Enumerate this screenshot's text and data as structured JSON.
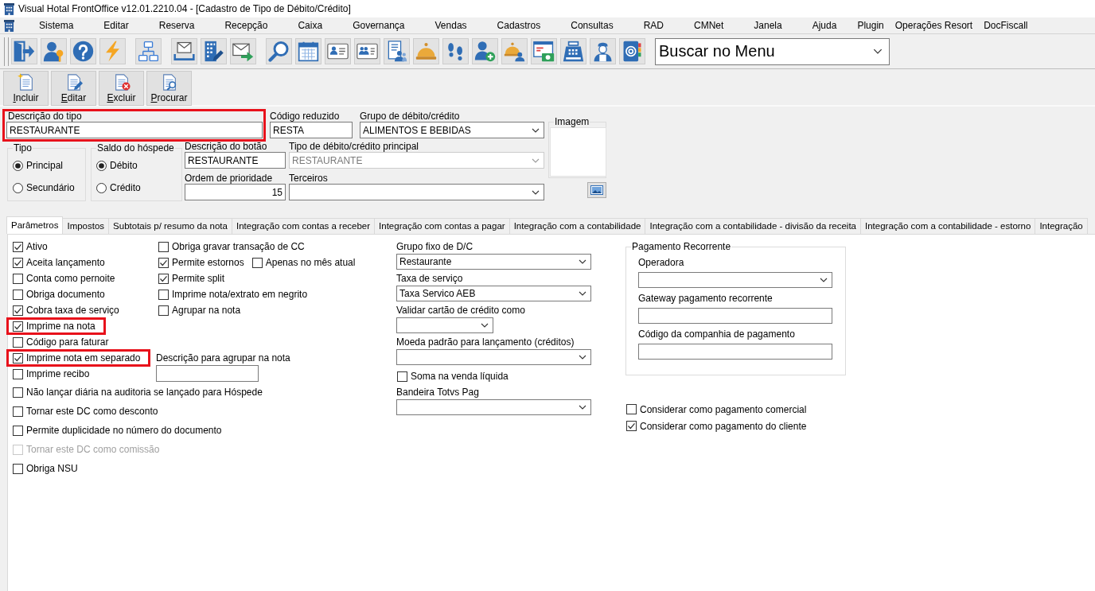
{
  "window": {
    "title": "Visual Hotal FrontOffice v12.01.2210.04 - [Cadastro de Tipo de Débito/Crédito]"
  },
  "menu_bar": [
    "Sistema",
    "Editar",
    "Reserva",
    "Recepção",
    "Caixa",
    "Governança",
    "Vendas",
    "Cadastros",
    "Consultas",
    "RAD",
    "CMNet",
    "Janela",
    "Ajuda",
    "Plugin",
    "Operações Resort",
    "DocFiscall"
  ],
  "toolbar": {
    "menu_search": {
      "value": "Buscar no Menu"
    }
  },
  "action_buttons": [
    "Incluir",
    "Editar",
    "Excluir",
    "Procurar"
  ],
  "form": {
    "descricao_do_tipo": {
      "label": "Descrição do tipo",
      "value": "RESTAURANTE",
      "highlighted": true
    },
    "codigo_reduzido": {
      "label": "Código reduzido",
      "value": "RESTA"
    },
    "grupo_de_debito_credito": {
      "label": "Grupo de débito/crédito",
      "value": "ALIMENTOS E BEBIDAS"
    },
    "imagem": {
      "label": "Imagem"
    },
    "tipo": {
      "label": "Tipo",
      "options": [
        {
          "label": "Principal",
          "selected": true
        },
        {
          "label": "Secundário",
          "selected": false
        }
      ]
    },
    "saldo_do_hospede": {
      "label": "Saldo do hóspede",
      "options": [
        {
          "label": "Débito",
          "selected": true
        },
        {
          "label": "Crédito",
          "selected": false
        }
      ]
    },
    "descricao_do_botao": {
      "label": "Descrição do botão",
      "value": "RESTAURANTE"
    },
    "tipo_principal": {
      "label": "Tipo de débito/crédito principal",
      "value": "RESTAURANTE",
      "disabled": true
    },
    "ordem_de_prioridade": {
      "label": "Ordem de prioridade",
      "value": "15"
    },
    "terceiros": {
      "label": "Terceiros"
    }
  },
  "tabs": [
    {
      "label": "Parâmetros",
      "selected": true
    },
    {
      "label": "Impostos",
      "selected": false
    },
    {
      "label": "Subtotais p/ resumo da nota",
      "selected": false
    },
    {
      "label": "Integração com contas a receber",
      "selected": false
    },
    {
      "label": "Integração com contas a pagar",
      "selected": false
    },
    {
      "label": "Integração com a contabilidade",
      "selected": false
    },
    {
      "label": "Integração com a contabilidade - divisão da receita",
      "selected": false
    },
    {
      "label": "Integração com a contabilidade - estorno",
      "selected": false
    },
    {
      "label": "Integração",
      "selected": false
    }
  ],
  "parametros": {
    "column_1": [
      {
        "label": "Ativo",
        "checked": true,
        "disabled": false,
        "highlighted": false
      },
      {
        "label": "Aceita lançamento",
        "checked": true,
        "disabled": false,
        "highlighted": false
      },
      {
        "label": "Conta como pernoite",
        "checked": false,
        "disabled": false,
        "highlighted": false
      },
      {
        "label": "Obriga documento",
        "checked": false,
        "disabled": false,
        "highlighted": false
      },
      {
        "label": "Cobra taxa de serviço",
        "checked": true,
        "disabled": false,
        "highlighted": false
      },
      {
        "label": "Imprime na nota",
        "checked": true,
        "disabled": false,
        "highlighted": true
      },
      {
        "label": "Código para faturar",
        "checked": false,
        "disabled": false,
        "highlighted": false
      },
      {
        "label": "Imprime nota em separado",
        "checked": true,
        "disabled": false,
        "highlighted": true
      },
      {
        "label": "Imprime recibo",
        "checked": false,
        "disabled": false,
        "highlighted": false
      },
      {
        "label": "Não lançar diária na auditoria se lançado para Hóspede",
        "checked": false,
        "disabled": false,
        "highlighted": false
      },
      {
        "label": "Tornar este DC como desconto",
        "checked": false,
        "disabled": false,
        "highlighted": false
      },
      {
        "label": "Permite duplicidade no número do documento",
        "checked": false,
        "disabled": false,
        "highlighted": false
      },
      {
        "label": "Tornar este DC como comissão",
        "checked": false,
        "disabled": true,
        "highlighted": false
      },
      {
        "label": "Obriga NSU",
        "checked": false,
        "disabled": false,
        "highlighted": false
      }
    ],
    "column_2": [
      [
        {
          "label": "Obriga gravar transação de CC",
          "checked": false
        }
      ],
      [
        {
          "label": "Permite estornos",
          "checked": true
        },
        {
          "label": "Apenas no mês atual",
          "checked": false
        }
      ],
      [
        {
          "label": "Permite split",
          "checked": true
        }
      ],
      [
        {
          "label": "Imprime nota/extrato em negrito",
          "checked": false
        }
      ],
      [
        {
          "label": "Agrupar na nota",
          "checked": false
        }
      ]
    ],
    "descricao_para_agrupar": {
      "label": "Descrição para agrupar na nota"
    },
    "column_3": [
      {
        "kind": "select",
        "label": "Grupo fixo de D/C",
        "value": "Restaurante"
      },
      {
        "kind": "select",
        "label": "Taxa de serviço",
        "value": "Taxa Servico AEB"
      },
      {
        "kind": "select",
        "label": "Validar cartão de crédito como"
      },
      {
        "kind": "select",
        "label": "Moeda padrão para lançamento (créditos)"
      },
      {
        "kind": "checkbox",
        "label": "Soma na venda líquida",
        "checked": false
      },
      {
        "kind": "select",
        "label": "Bandeira Totvs Pag"
      }
    ],
    "pagamento_recorrente": {
      "title": "Pagamento Recorrente",
      "fields": [
        {
          "kind": "select",
          "label": "Operadora"
        },
        {
          "kind": "text",
          "label": "Gateway pagamento recorrente"
        },
        {
          "kind": "text",
          "label": "Código da companhia de pagamento"
        }
      ]
    },
    "considerar": [
      {
        "label": "Considerar como pagamento comercial",
        "checked": false
      },
      {
        "label": "Considerar como pagamento do cliente",
        "checked": true
      }
    ]
  }
}
